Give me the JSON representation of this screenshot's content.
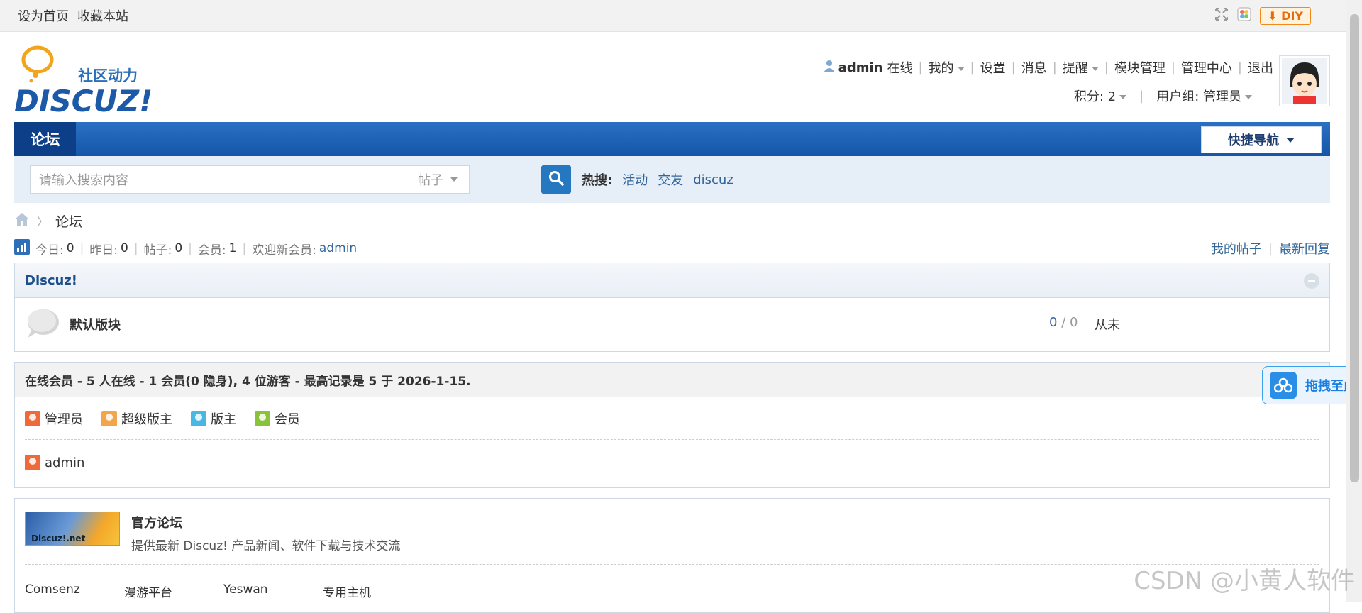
{
  "topbar": {
    "set_home": "设为首页",
    "bookmark": "收藏本站",
    "diy_label": "DIY"
  },
  "logo": {
    "slogan": "社区动力",
    "brand": "DISCUZ!"
  },
  "user_nav": {
    "username": "admin",
    "status": "在线",
    "items": [
      "我的",
      "设置",
      "消息",
      "提醒",
      "模块管理",
      "管理中心",
      "退出"
    ],
    "credits_label": "积分: 2",
    "group_label": "用户组: 管理员"
  },
  "nav": {
    "active_tab": "论坛",
    "quick_nav": "快捷导航"
  },
  "search": {
    "placeholder": "请输入搜索内容",
    "type": "帖子",
    "hot_label": "热搜:",
    "hot": [
      "活动",
      "交友",
      "discuz"
    ]
  },
  "breadcrumb": {
    "current": "论坛"
  },
  "stats": {
    "today_label": "今日:",
    "today": "0",
    "yesterday_label": "昨日:",
    "yesterday": "0",
    "posts_label": "帖子:",
    "posts": "0",
    "members_label": "会员:",
    "members": "1",
    "welcome_label": "欢迎新会员:",
    "newest": "admin",
    "my_posts": "我的帖子",
    "latest_replies": "最新回复"
  },
  "category": {
    "title": "Discuz!",
    "forum_name": "默认版块",
    "threads": "0",
    "posts": "0",
    "last_post": "从未"
  },
  "online": {
    "header": "在线会员 - 5 人在线 - 1 会员(0 隐身), 4 位游客 - 最高记录是 5 于 2026-1-15.",
    "legend": [
      "管理员",
      "超级版主",
      "版主",
      "会员"
    ],
    "legend_colors": [
      "#ef6a3a",
      "#f2a54a",
      "#49b7e3",
      "#8ac33a"
    ],
    "users": [
      "admin"
    ]
  },
  "links": {
    "official_image_text": "Discuz!.net",
    "official_title": "官方论坛",
    "official_desc": "提供最新 Discuz! 产品新闻、软件下载与技术交流",
    "friends": [
      "Comsenz",
      "漫游平台",
      "Yeswan",
      "专用主机"
    ]
  },
  "float": {
    "drag_text": "拖拽至此"
  },
  "watermark": "CSDN @小黄人软件"
}
